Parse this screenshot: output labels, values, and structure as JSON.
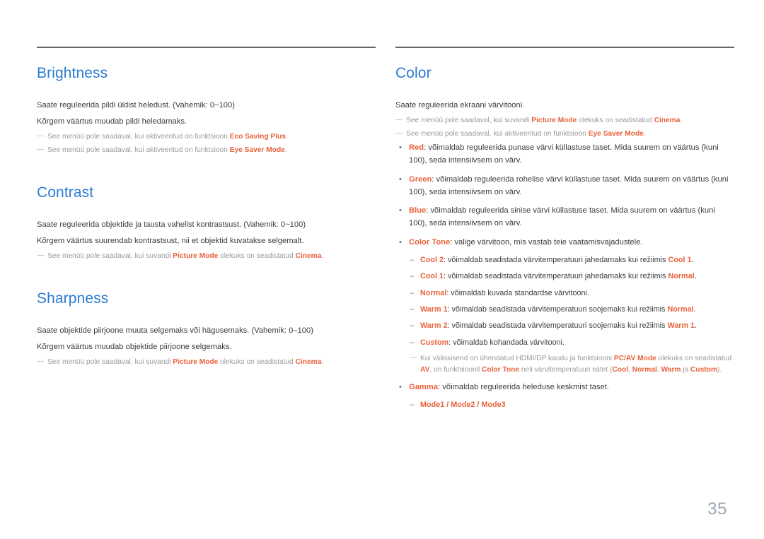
{
  "page": {
    "number": "35"
  },
  "left_column": {
    "sections": [
      {
        "title": "Brightness",
        "lines": [
          "Saate reguleerida pildi üldist heledust. (Vahemik: 0~100)",
          "Kõrgem väärtus muudab pildi heledamaks."
        ],
        "notes": [
          {
            "dash": "—",
            "pre": "See menüü pole saadaval, kui aktiveeritud on funktsioon ",
            "accent": "Eco Saving Plus",
            "post": "."
          },
          {
            "dash": "—",
            "pre": "See menüü pole saadaval, kui aktiveeritud on funktsioon ",
            "accent": "Eye Saver Mode",
            "post": "."
          }
        ]
      },
      {
        "title": "Contrast",
        "lines": [
          "Saate reguleerida objektide ja tausta vahelist kontrastsust. (Vahemik: 0~100)",
          "Kõrgem väärtus suurendab kontrastsust, nii et objektid kuvatakse selgemalt."
        ],
        "notes": [
          {
            "dash": "—",
            "pre": "See menüü pole saadaval, kui suvandi ",
            "accent": "Picture Mode",
            "mid": " olekuks on seadistatud ",
            "accent2": "Cinema",
            "post": "."
          }
        ]
      },
      {
        "title": "Sharpness",
        "lines": [
          "Saate objektide piirjoone muuta selgemaks või hägusemaks. (Vahemik: 0–100)",
          "Kõrgem väärtus muudab objektide piirjoone selgemaks."
        ],
        "notes": [
          {
            "dash": "—",
            "pre": "See menüü pole saadaval, kui suvandi ",
            "accent": "Picture Mode",
            "mid": " olekuks on seadistatud ",
            "accent2": "Cinema",
            "post": "."
          }
        ]
      }
    ]
  },
  "right_column": {
    "title": "Color",
    "intro": "Saate reguleerida ekraani värvitooni.",
    "notes": [
      {
        "dash": "—",
        "pre": "See menüü pole saadaval, kui suvandi ",
        "accent": "Picture Mode",
        "mid": " olekuks on seadistatud ",
        "accent2": "Cinema",
        "post": "."
      },
      {
        "dash": "—",
        "pre": "See menüü pole saadaval, kui aktiveeritud on funktsioon ",
        "accent": "Eye Saver Mode",
        "post": "."
      }
    ],
    "bullets": {
      "red": {
        "dot": "•",
        "label": "Red",
        "text": ": võimaldab reguleerida punase värvi küllastuse taset. Mida suurem on väärtus (kuni 100), seda intensiivsem on värv."
      },
      "green": {
        "dot": "•",
        "label": "Green",
        "text": ": võimaldab reguleerida rohelise värvi küllastuse taset. Mida suurem on väärtus (kuni 100), seda intensiivsem on värv."
      },
      "blue": {
        "dot": "•",
        "label": "Blue",
        "text": ": võimaldab reguleerida sinise värvi küllastuse taset. Mida suurem on väärtus (kuni 100), seda intensiivsem on värv."
      },
      "color_tone": {
        "dot": "•",
        "label": "Color Tone",
        "text": ": valige värvitoon, mis vastab teie vaatamisvajadustele.",
        "sub": [
          {
            "dash": "–",
            "label": "Cool 2",
            "mid": ": võimaldab seadistada värvitemperatuuri jahedamaks kui režiimis ",
            "ref": "Cool 1",
            "post": "."
          },
          {
            "dash": "–",
            "label": "Cool 1",
            "mid": ": võimaldab seadistada värvitemperatuuri jahedamaks kui režiimis ",
            "ref": "Normal",
            "post": "."
          },
          {
            "dash": "–",
            "label": "Normal",
            "mid": ": võimaldab kuvada standardse värvitooni.",
            "ref": "",
            "post": ""
          },
          {
            "dash": "–",
            "label": "Warm 1",
            "mid": ": võimaldab seadistada värvitemperatuuri soojemaks kui režiimis ",
            "ref": "Normal",
            "post": "."
          },
          {
            "dash": "–",
            "label": "Warm 2",
            "mid": ": võimaldab seadistada värvitemperatuuri soojemaks kui režiimis ",
            "ref": "Warm 1",
            "post": "."
          },
          {
            "dash": "–",
            "label": "Custom",
            "mid": ": võimaldab kohandada värvitooni.",
            "ref": "",
            "post": ""
          }
        ],
        "note": {
          "dash": "—",
          "p1": "Kui välissisend on ühendatud HDMI/DP kaudu ja funktsiooni ",
          "a1": "PC/AV Mode",
          "p2": " olekuks on seadistatud ",
          "a2": "AV",
          "p3": ", on funktsioonil ",
          "a3": "Color Tone",
          "p4": " neli värvitemperatuuri sätet (",
          "a4": "Cool",
          "p5": ", ",
          "a5": "Normal",
          "p6": ", ",
          "a6": "Warm",
          "p7": " ja ",
          "a7": "Custom",
          "p8": ")."
        }
      },
      "gamma": {
        "dot": "•",
        "label": "Gamma",
        "text": ": võimaldab reguleerida heleduse keskmist taset.",
        "sub": [
          {
            "dash": "–",
            "modes": "Mode1 / Mode2 / Mode3"
          }
        ]
      }
    }
  }
}
